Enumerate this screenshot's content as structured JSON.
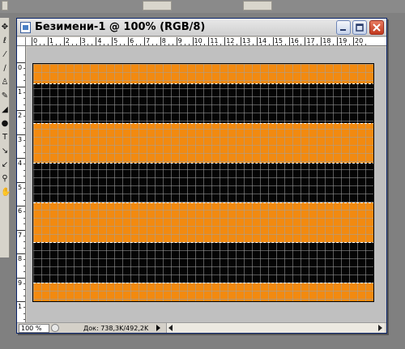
{
  "document": {
    "title": "Безимени-1 @ 100% (RGB/8)"
  },
  "rulers": {
    "horizontal_ticks": [
      "0",
      "1",
      "2",
      "3",
      "4",
      "5",
      "6",
      "7",
      "8",
      "9",
      "10",
      "11",
      "12",
      "13",
      "14",
      "15",
      "16",
      "17",
      "18",
      "19",
      "20"
    ],
    "vertical_ticks": [
      "0",
      "1",
      "2",
      "3",
      "4",
      "5",
      "6",
      "7",
      "8",
      "9",
      "1"
    ]
  },
  "canvas": {
    "stripe_colors": [
      "#f28a10",
      "#050505",
      "#f28a10",
      "#050505",
      "#f28a10",
      "#050505",
      "#f28a10"
    ],
    "grid": true,
    "selection_active": true
  },
  "statusbar": {
    "zoom": "100 %",
    "doc_info": "Док: 738,3K/492,2K"
  },
  "toolbox": {
    "tools": [
      "move-tool",
      "lasso-tool",
      "magic-wand-tool",
      "brush-tool",
      "stamp-tool",
      "history-brush-tool",
      "eraser-tool",
      "blur-tool",
      "type-tool",
      "path-tool",
      "eyedropper-tool",
      "zoom-tool",
      "hand-tool"
    ]
  },
  "colors": {
    "orange": "#f28a10",
    "black": "#050505",
    "pasteboard": "#c0c0c0",
    "close_button": "#c2391d"
  }
}
